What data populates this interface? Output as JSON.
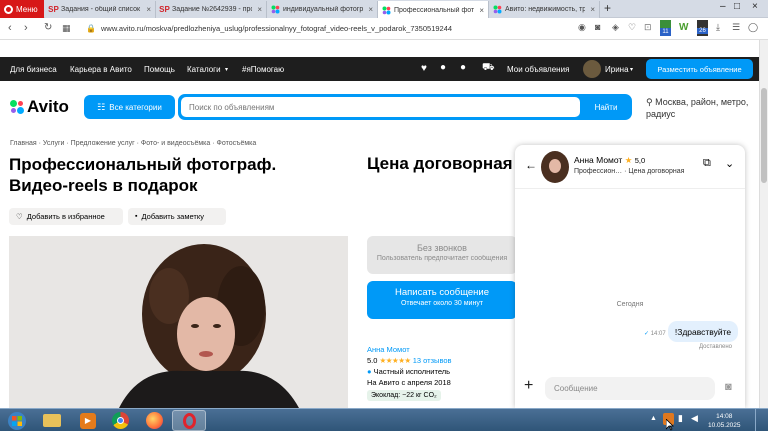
{
  "browser": {
    "menu_label": "Меню",
    "tabs": [
      {
        "icon": "sp-icon",
        "label": "Задания - общий список -"
      },
      {
        "icon": "sp-icon",
        "label": "Задание №2642939 - про"
      },
      {
        "icon": "avito-icon",
        "label": "индивидуальный фотогр"
      },
      {
        "icon": "avito-icon",
        "label": "Профессиональный фото",
        "active": true
      },
      {
        "icon": "avito-icon",
        "label": "Авито: недвижимость, тра"
      }
    ],
    "url": "www.avito.ru/moskva/predlozheniya_uslug/professionalnyy_fotograf_video-reels_v_podarok_7350519244",
    "badges": [
      "11",
      "26"
    ]
  },
  "avito_nav": {
    "items": [
      "Для бизнеса",
      "Карьера в Авито",
      "Помощь",
      "Каталоги",
      "#яПомогаю"
    ],
    "my_ads": "Мои объявления",
    "user": "Ирина",
    "post_button": "Разместить объявление"
  },
  "search": {
    "logo": "Avito",
    "categories_button": "Все категории",
    "placeholder": "Поиск по объявлениям",
    "find_button": "Найти",
    "location": "Москва, район, метро, радиус"
  },
  "listing": {
    "breadcrumbs": [
      "Главная",
      "Услуги",
      "Предложение услуг",
      "Фото- и видеосъёмка",
      "Фотосъёмка"
    ],
    "title": "Профессиональный фотограф. Видео-reels в подарок",
    "price": "Цена договорная",
    "favorite": "Добавить в избранное",
    "note": "Добавить заметку",
    "no_calls_title": "Без звонков",
    "no_calls_sub": "Пользователь предпочитает сообщения",
    "write_title": "Написать сообщение",
    "write_sub": "Отвечает около 30 минут",
    "seller": {
      "name": "Анна Момот",
      "rating": "5.0",
      "stars": 5,
      "reviews": "13 отзывов",
      "type": "Частный исполнитель",
      "since": "На Авито с апреля 2018",
      "eco": "Экоклад: −22 кг CO₂"
    }
  },
  "chat": {
    "name": "Анна Момот",
    "rating": "5,0",
    "subtitle_service": "Профессион…",
    "subtitle_price": "Цена договорная",
    "day": "Сегодня",
    "messages": [
      {
        "time": "14:07",
        "text": "!Здравствуйте",
        "status": "Доставлено"
      }
    ],
    "input_placeholder": "Сообщение"
  },
  "taskbar": {
    "time": "14:08",
    "date": "10.05.2025"
  },
  "colors": {
    "accent": "#0099f7",
    "nav_bg": "#1e1e1e",
    "opera_red": "#d71818",
    "star": "#ffb021"
  }
}
